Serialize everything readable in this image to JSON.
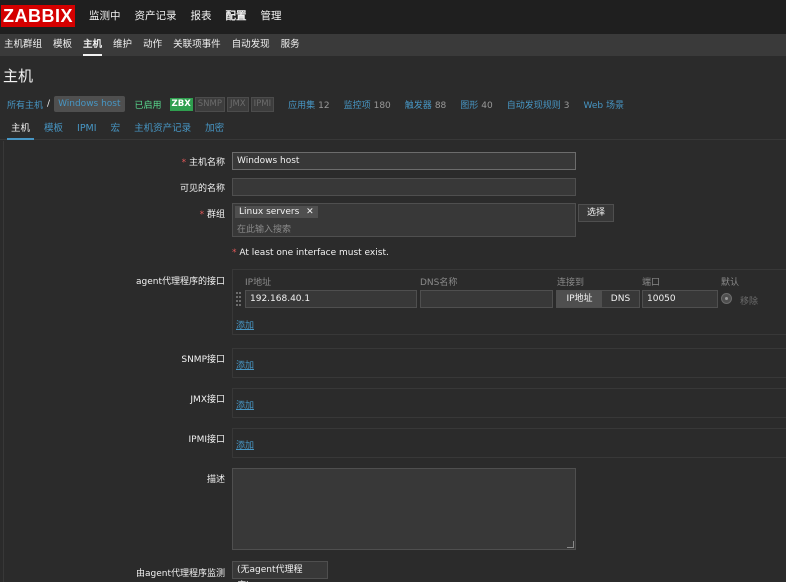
{
  "logo": "ZABBIX",
  "main_menu": [
    "监测中",
    "资产记录",
    "报表",
    "配置",
    "管理"
  ],
  "main_menu_selected": "配置",
  "sub_menu": [
    "主机群组",
    "模板",
    "主机",
    "维护",
    "动作",
    "关联项事件",
    "自动发现",
    "服务"
  ],
  "sub_menu_selected": "主机",
  "page_title": "主机",
  "breadcrumb": {
    "all_hosts": "所有主机",
    "separator": "/",
    "current_host": "Windows host",
    "status": "已启用",
    "badges": [
      "ZBX",
      "SNMP",
      "JMX",
      "IPMI"
    ],
    "items": [
      {
        "label": "应用集",
        "count": "12"
      },
      {
        "label": "监控项",
        "count": "180"
      },
      {
        "label": "触发器",
        "count": "88"
      },
      {
        "label": "图形",
        "count": "40"
      },
      {
        "label": "自动发现规则",
        "count": "3"
      },
      {
        "label": "Web 场景",
        "count": ""
      }
    ]
  },
  "tabs": [
    "主机",
    "模板",
    "IPMI",
    "宏",
    "主机资产记录",
    "加密"
  ],
  "tab_selected": "主机",
  "form": {
    "host_name_label": "主机名称",
    "host_name_value": "Windows host",
    "visible_name_label": "可见的名称",
    "visible_name_value": "",
    "groups_label": "群组",
    "group_chip": "Linux servers",
    "group_search_placeholder": "在此输入搜索",
    "select_button": "选择",
    "interface_warning": "At least one interface must exist.",
    "agent_iface_label": "agent代理程序的接口",
    "col_ip": "IP地址",
    "col_dns": "DNS名称",
    "col_connect": "连接到",
    "col_port": "端口",
    "col_default": "默认",
    "ip_value": "192.168.40.1",
    "dns_value": "",
    "connect_ip": "IP地址",
    "connect_dns": "DNS",
    "port_value": "10050",
    "remove_label": "移除",
    "add_label": "添加",
    "snmp_label": "SNMP接口",
    "jmx_label": "JMX接口",
    "ipmi_label": "IPMI接口",
    "description_label": "描述",
    "proxy_label": "由agent代理程序监测",
    "proxy_value": "(无agent代理程序)"
  },
  "colors": {
    "logo_bg": "#d40000",
    "link": "#4796c4",
    "enabled": "#59db8f",
    "zbx_badge": "#2f9f4f",
    "required": "#e45959"
  }
}
